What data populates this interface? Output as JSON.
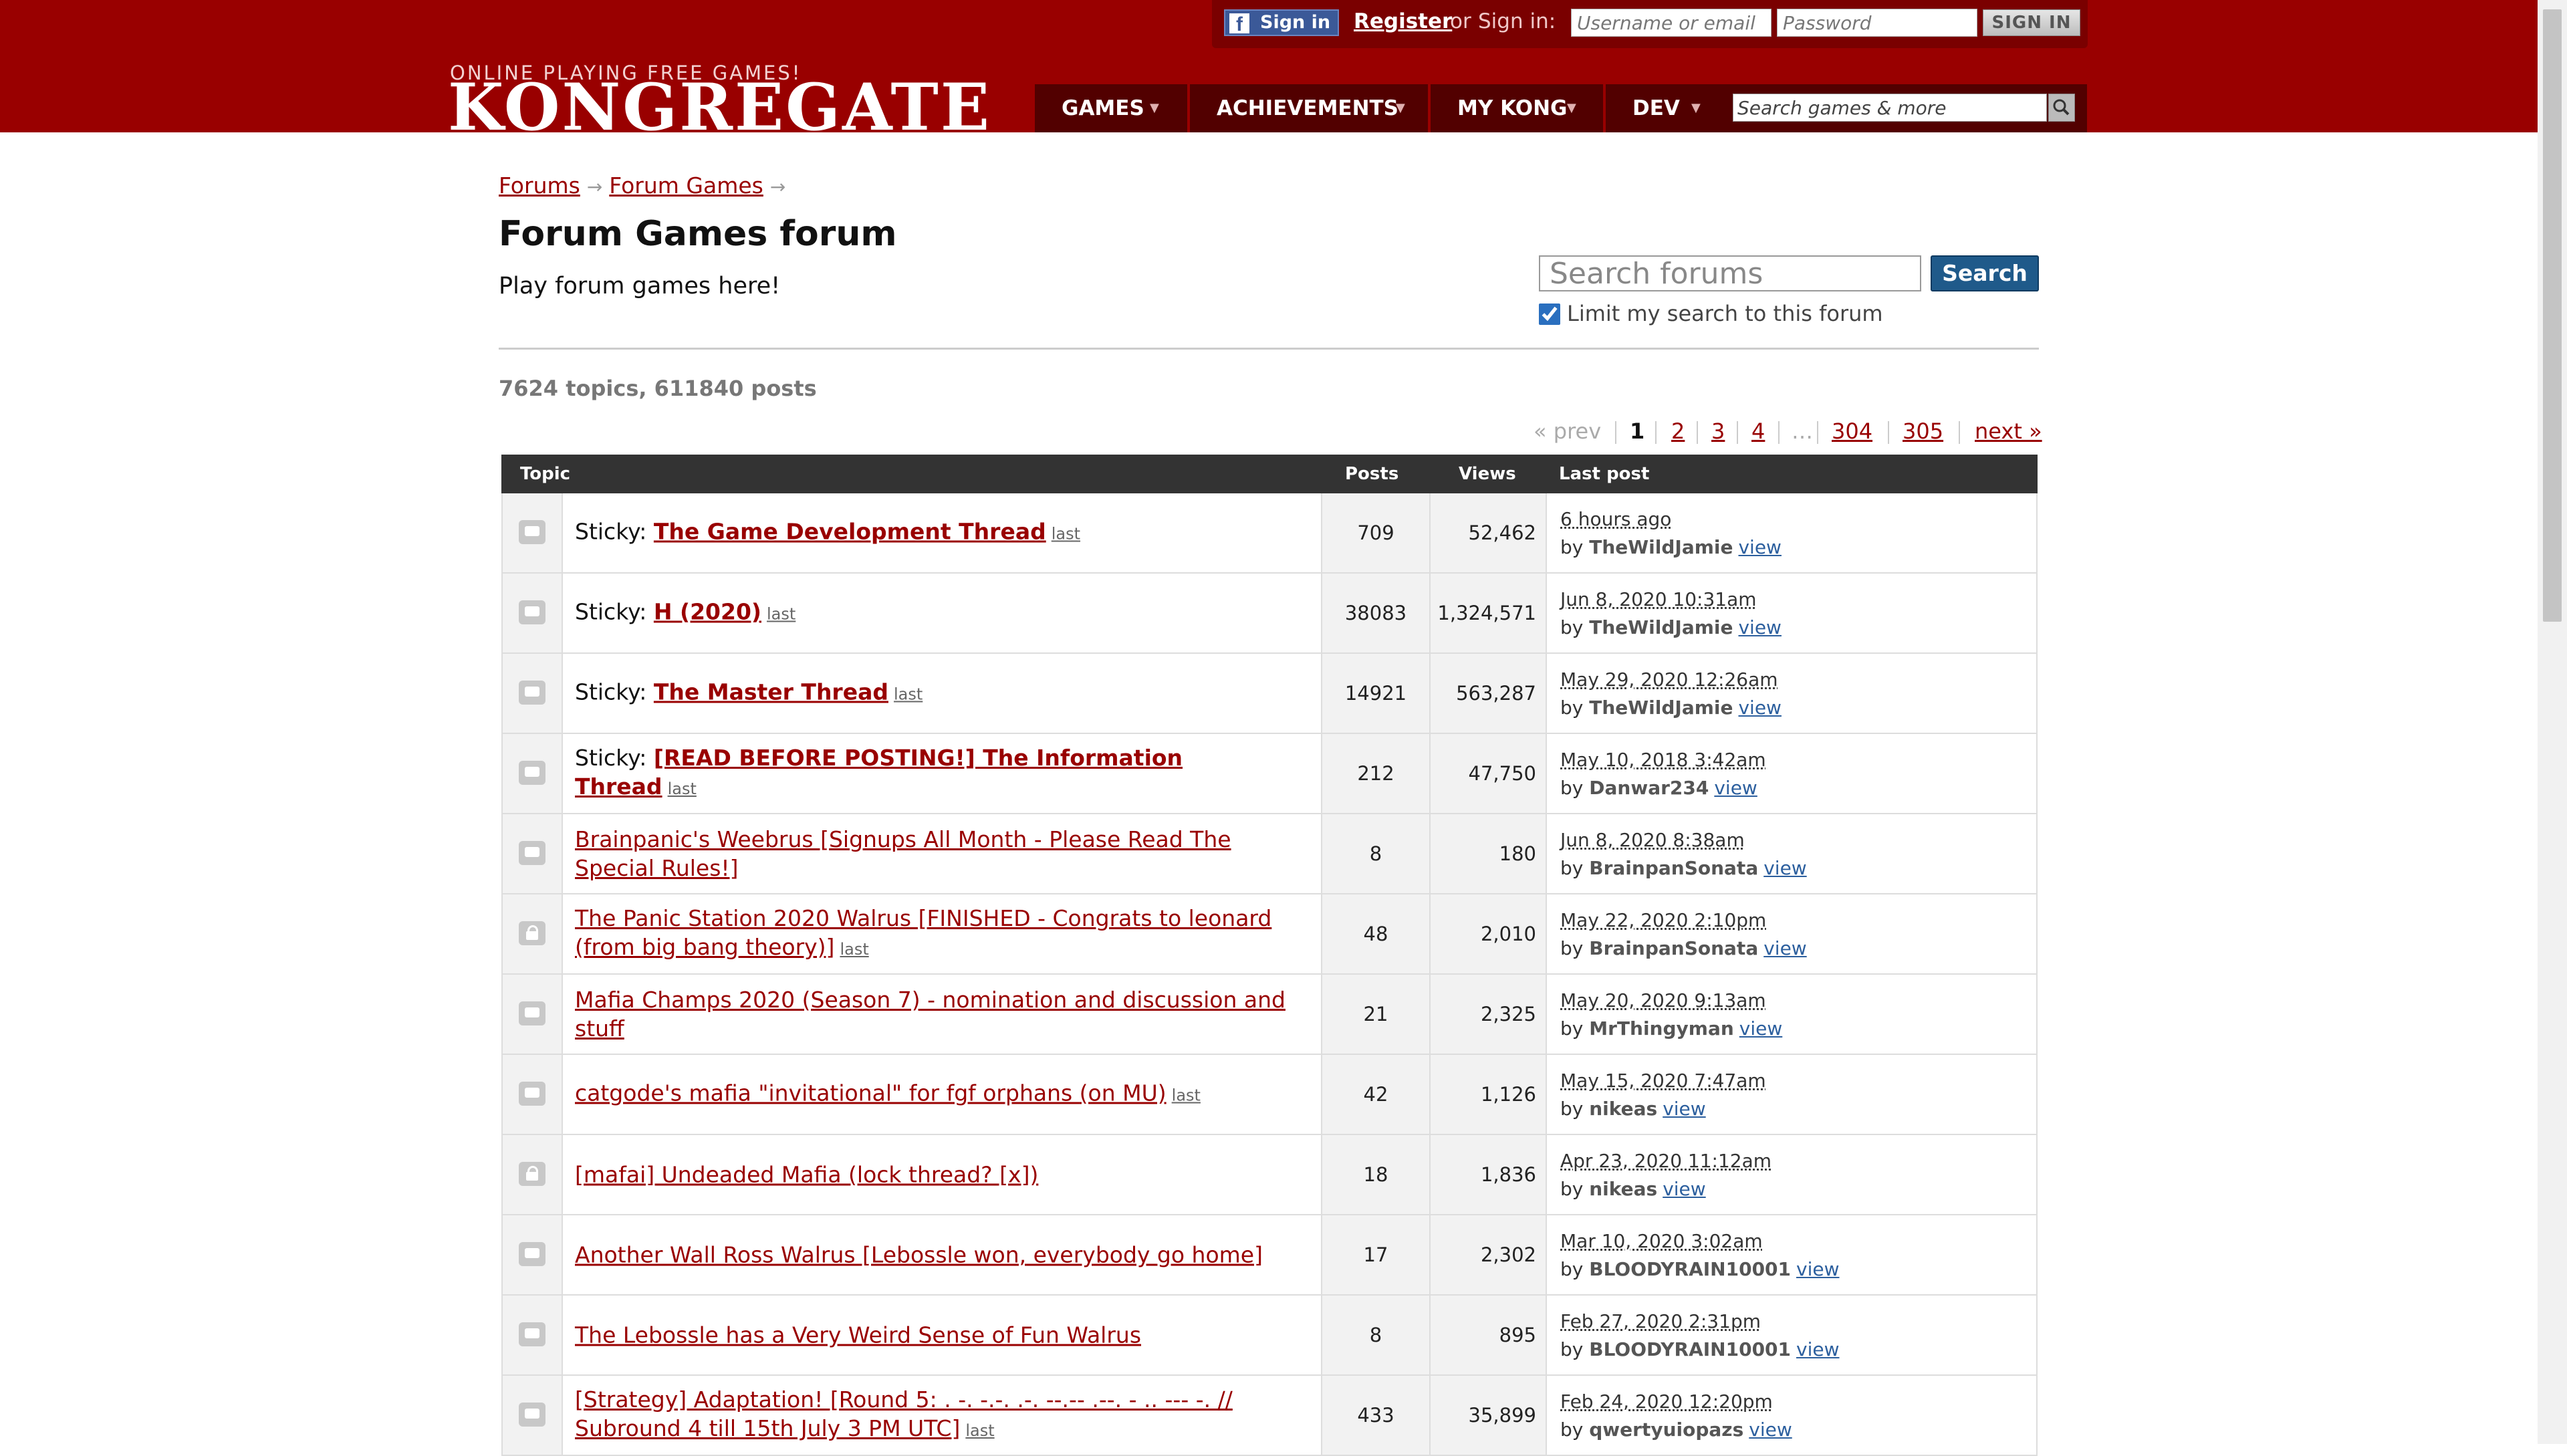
{
  "header": {
    "facebook_signin": "Sign in",
    "register": "Register",
    "or": "or",
    "signin_label": "Sign in:",
    "username_placeholder": "Username or email",
    "password_placeholder": "Password",
    "signin_button": "SIGN IN",
    "tagline": "ONLINE PLAYING FREE GAMES!",
    "logo": "KONGREGATE",
    "nav": [
      "GAMES",
      "ACHIEVEMENTS",
      "MY KONG",
      "DEV"
    ],
    "nav_caret": "▼",
    "search_placeholder": "Search games & more"
  },
  "breadcrumb": [
    "Forums",
    "Forum Games"
  ],
  "breadcrumb_arrow": "→",
  "forum": {
    "title": "Forum Games forum",
    "description": "Play forum games here!",
    "search_placeholder": "Search forums",
    "search_button": "Search",
    "limit_label": "Limit my search to this forum",
    "limit_checked": true,
    "stats": "7624 topics, 611840 posts"
  },
  "pagination": {
    "prev": "« prev",
    "current": "1",
    "pages": [
      "2",
      "3",
      "4"
    ],
    "ellipsis": "…",
    "last_pages": [
      "304",
      "305"
    ],
    "next": "next »"
  },
  "table": {
    "headers": {
      "topic": "Topic",
      "posts": "Posts",
      "views": "Views",
      "last_post": "Last post"
    },
    "by": "by",
    "view": "view",
    "last": "last",
    "sticky_prefix": "Sticky:",
    "rows": [
      {
        "sticky": true,
        "locked": false,
        "title": "The Game Development Thread",
        "show_last": true,
        "posts": "709",
        "views": "52,462",
        "date": "6 hours ago",
        "author": "TheWildJamie"
      },
      {
        "sticky": true,
        "locked": false,
        "title": "H (2020)",
        "show_last": true,
        "posts": "38083",
        "views": "1,324,571",
        "date": "Jun 8, 2020 10:31am",
        "author": "TheWildJamie"
      },
      {
        "sticky": true,
        "locked": false,
        "title": "The Master Thread",
        "show_last": true,
        "posts": "14921",
        "views": "563,287",
        "date": "May 29, 2020 12:26am",
        "author": "TheWildJamie"
      },
      {
        "sticky": true,
        "locked": false,
        "title": "[READ BEFORE POSTING!] The Information Thread",
        "show_last": true,
        "posts": "212",
        "views": "47,750",
        "date": "May 10, 2018 3:42am",
        "author": "Danwar234"
      },
      {
        "sticky": false,
        "locked": false,
        "title": "Brainpanic's Weebrus [Signups All Month - Please Read The Special Rules!]",
        "show_last": false,
        "posts": "8",
        "views": "180",
        "date": "Jun 8, 2020 8:38am",
        "author": "BrainpanSonata"
      },
      {
        "sticky": false,
        "locked": true,
        "title": "The Panic Station 2020 Walrus [FINISHED - Congrats to leonard (from big bang theory)]",
        "show_last": true,
        "posts": "48",
        "views": "2,010",
        "date": "May 22, 2020 2:10pm",
        "author": "BrainpanSonata"
      },
      {
        "sticky": false,
        "locked": false,
        "title": "Mafia Champs 2020 (Season 7) - nomination and discussion and stuff",
        "show_last": false,
        "posts": "21",
        "views": "2,325",
        "date": "May 20, 2020 9:13am",
        "author": "MrThingyman"
      },
      {
        "sticky": false,
        "locked": false,
        "title": "catgode's mafia \"invitational\" for fgf orphans (on MU)",
        "show_last": true,
        "posts": "42",
        "views": "1,126",
        "date": "May 15, 2020 7:47am",
        "author": "nikeas"
      },
      {
        "sticky": false,
        "locked": true,
        "title": "[mafai] Undeaded Mafia (lock thread? [x])",
        "show_last": false,
        "posts": "18",
        "views": "1,836",
        "date": "Apr 23, 2020 11:12am",
        "author": "nikeas"
      },
      {
        "sticky": false,
        "locked": false,
        "title": "Another Wall Ross Walrus [Lebossle won, everybody go home]",
        "show_last": false,
        "posts": "17",
        "views": "2,302",
        "date": "Mar 10, 2020 3:02am",
        "author": "BLOODYRAIN10001"
      },
      {
        "sticky": false,
        "locked": false,
        "title": "The Lebossle has a Very Weird Sense of Fun Walrus",
        "show_last": false,
        "posts": "8",
        "views": "895",
        "date": "Feb 27, 2020 2:31pm",
        "author": "BLOODYRAIN10001"
      },
      {
        "sticky": false,
        "locked": false,
        "title": "[Strategy] Adaptation! [Round 5: . -. -.-. .-. --.-- .--. - .. --- -. // Subround 4 till 15th July 3 PM UTC]",
        "show_last": true,
        "posts": "433",
        "views": "35,899",
        "date": "Feb 24, 2020 12:20pm",
        "author": "qwertyuiopazs"
      }
    ]
  },
  "colors": {
    "brand": "#990000",
    "nav_dark": "#520000",
    "table_header": "#333333",
    "search_button": "#1f5a8a"
  }
}
